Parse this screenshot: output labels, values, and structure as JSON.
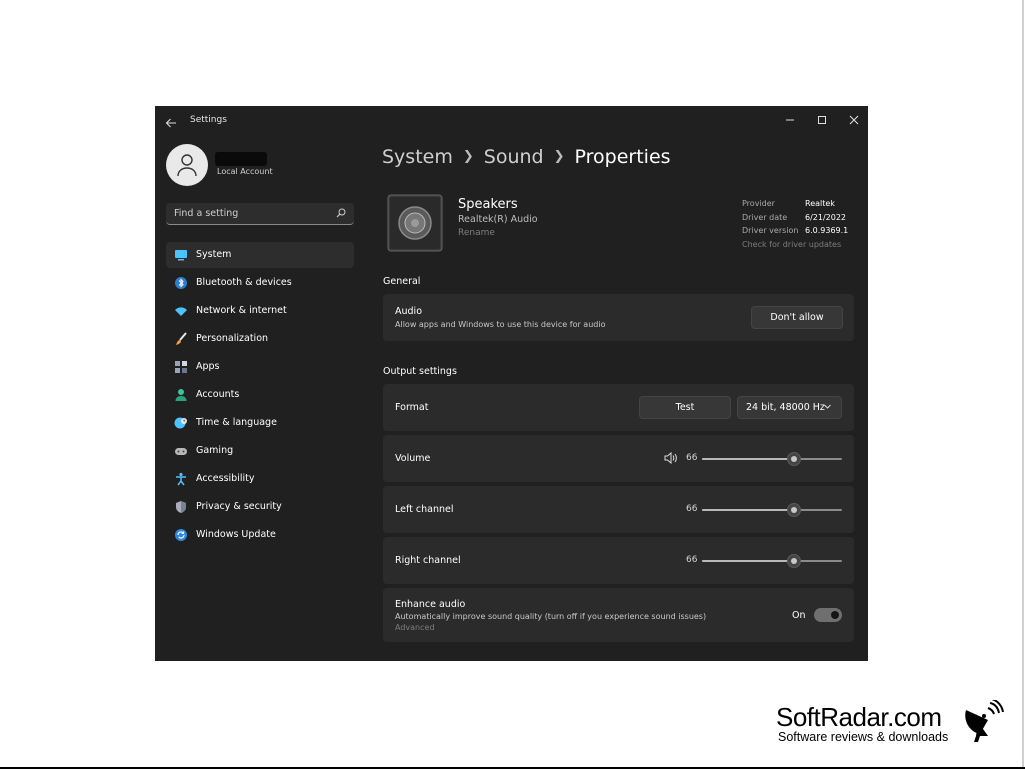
{
  "window": {
    "title": "Settings"
  },
  "account": {
    "type": "Local Account"
  },
  "search": {
    "placeholder": "Find a setting"
  },
  "sidebar": {
    "items": [
      {
        "label": "System",
        "icon": "system-icon"
      },
      {
        "label": "Bluetooth & devices",
        "icon": "bluetooth-icon"
      },
      {
        "label": "Network & internet",
        "icon": "wifi-icon"
      },
      {
        "label": "Personalization",
        "icon": "brush-icon"
      },
      {
        "label": "Apps",
        "icon": "apps-icon"
      },
      {
        "label": "Accounts",
        "icon": "person-icon"
      },
      {
        "label": "Time & language",
        "icon": "globe-clock-icon"
      },
      {
        "label": "Gaming",
        "icon": "gamepad-icon"
      },
      {
        "label": "Accessibility",
        "icon": "accessibility-icon"
      },
      {
        "label": "Privacy & security",
        "icon": "shield-icon"
      },
      {
        "label": "Windows Update",
        "icon": "update-icon"
      }
    ],
    "active": "System"
  },
  "breadcrumb": {
    "level1": "System",
    "level2": "Sound",
    "level3": "Properties"
  },
  "device": {
    "name": "Speakers",
    "subtitle": "Realtek(R) Audio",
    "rename_link": "Rename",
    "provider_label": "Provider",
    "provider": "Realtek",
    "driver_date_label": "Driver date",
    "driver_date": "6/21/2022",
    "driver_version_label": "Driver version",
    "driver_version": "6.0.9369.1",
    "check_updates_link": "Check for driver updates"
  },
  "general": {
    "title": "General",
    "audio": {
      "title": "Audio",
      "description": "Allow apps and Windows to use this device for audio",
      "button": "Don't allow"
    }
  },
  "output": {
    "title": "Output settings",
    "format": {
      "label": "Format",
      "test_button": "Test",
      "selected": "24 bit, 48000 Hz"
    },
    "volume": {
      "label": "Volume",
      "value": "66"
    },
    "left_channel": {
      "label": "Left channel",
      "value": "66"
    },
    "right_channel": {
      "label": "Right channel",
      "value": "66"
    },
    "enhance": {
      "title": "Enhance audio",
      "description": "Automatically improve sound quality (turn off if you experience sound issues)",
      "advanced_link": "Advanced",
      "toggle_label": "On"
    }
  },
  "colors": {
    "window_bg": "#202020",
    "card_bg": "#2b2b2b",
    "accent": "#4cc2ff"
  },
  "watermark": {
    "brand": "SoftRadar.com",
    "tagline": "Software reviews & downloads"
  }
}
